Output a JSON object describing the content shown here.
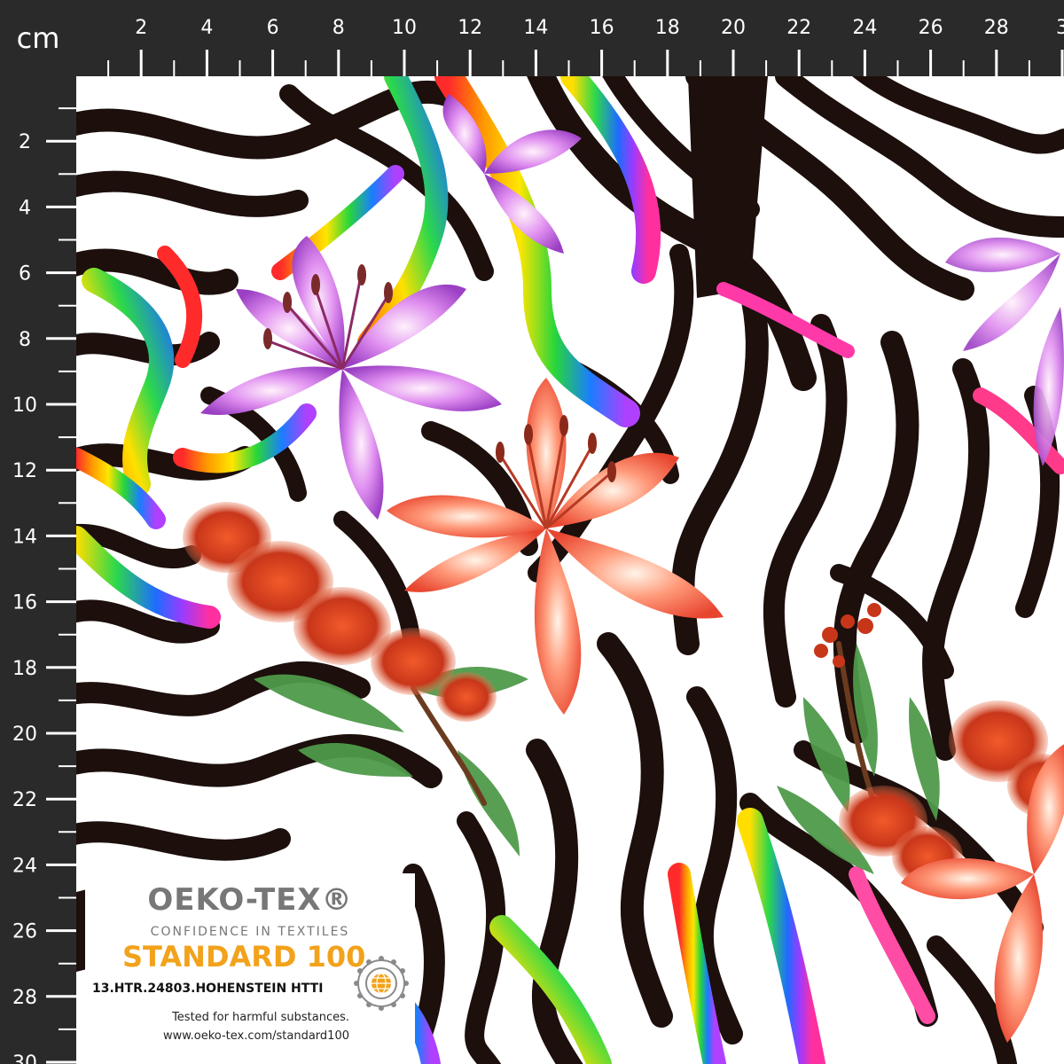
{
  "ruler": {
    "unit": "cm",
    "top_labels": [
      "2",
      "4",
      "6",
      "8",
      "10",
      "12",
      "14",
      "16",
      "18",
      "20",
      "22",
      "24",
      "26",
      "28",
      "3"
    ],
    "left_labels": [
      "2",
      "4",
      "6",
      "8",
      "10",
      "12",
      "14",
      "16",
      "18",
      "20",
      "22",
      "24",
      "26",
      "28",
      "30"
    ]
  },
  "fabric": {
    "pattern": "zebra stripes with rainbow streaks and watercolor lilies and bottlebrush blossoms",
    "colors": {
      "stripe_dark": "#1c0f0c",
      "stripe_light": "#ffffff",
      "lily_pink": "#c66fd9",
      "lily_coral": "#f2694f",
      "bottlebrush": "#d9441f",
      "leaf": "#4f9a4a"
    }
  },
  "badge": {
    "brand": "OEKO-TEX®",
    "tagline": "CONFIDENCE IN TEXTILES",
    "standard": "STANDARD 100",
    "cert": "13.HTR.24803.HOHENSTEIN HTTI",
    "tested": "Tested for harmful substances.",
    "url": "www.oeko-tex.com/standard100",
    "logo_icon": "globe-emblem-icon",
    "accent": "#f2a21b"
  }
}
